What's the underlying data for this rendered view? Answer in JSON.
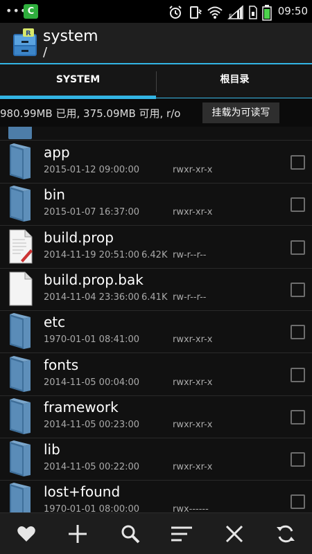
{
  "status_bar": {
    "dots": "•••",
    "app_badge": "C",
    "time": "09:50",
    "icons": [
      "alarm-icon",
      "vibrate-icon",
      "wifi-icon",
      "signal-icon",
      "sim-icon",
      "battery-icon"
    ]
  },
  "header": {
    "title": "system",
    "path": "/"
  },
  "tabs": [
    {
      "label": "SYSTEM",
      "active": true
    },
    {
      "label": "根目录",
      "active": false
    }
  ],
  "storage": {
    "info": "980.99MB 已用, 375.09MB 可用, r/o",
    "mount_button": "挂载为可读写"
  },
  "files": [
    {
      "name": "app",
      "type": "folder",
      "date": "2015-01-12 09:00:00",
      "size": "",
      "perm": "rwxr-xr-x"
    },
    {
      "name": "bin",
      "type": "folder",
      "date": "2015-01-07 16:37:00",
      "size": "",
      "perm": "rwxr-xr-x"
    },
    {
      "name": "build.prop",
      "type": "text-file",
      "date": "2014-11-19 20:51:00",
      "size": "6.42K",
      "perm": "rw-r--r--"
    },
    {
      "name": "build.prop.bak",
      "type": "file",
      "date": "2014-11-04 23:36:00",
      "size": "6.41K",
      "perm": "rw-r--r--"
    },
    {
      "name": "etc",
      "type": "folder",
      "date": "1970-01-01 08:41:00",
      "size": "",
      "perm": "rwxr-xr-x"
    },
    {
      "name": "fonts",
      "type": "folder",
      "date": "2014-11-05 00:04:00",
      "size": "",
      "perm": "rwxr-xr-x"
    },
    {
      "name": "framework",
      "type": "folder",
      "date": "2014-11-05 00:23:00",
      "size": "",
      "perm": "rwxr-xr-x"
    },
    {
      "name": "lib",
      "type": "folder",
      "date": "2014-11-05 00:22:00",
      "size": "",
      "perm": "rwxr-xr-x"
    },
    {
      "name": "lost+found",
      "type": "folder",
      "date": "1970-01-01 08:00:00",
      "size": "",
      "perm": "rwx------"
    }
  ],
  "toolbar": [
    "favorite-icon",
    "add-icon",
    "search-icon",
    "sort-icon",
    "close-icon",
    "refresh-icon"
  ],
  "colors": {
    "accent": "#33b5e5",
    "folder": "#4d7da8",
    "background": "#111111"
  }
}
